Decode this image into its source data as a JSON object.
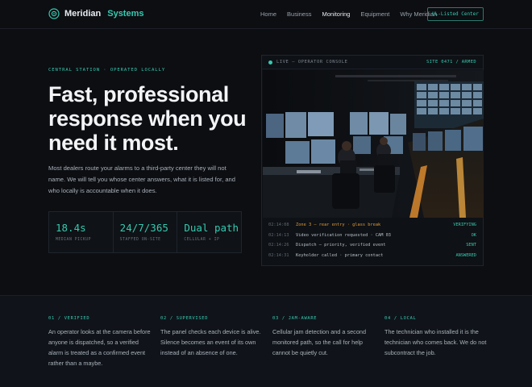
{
  "brand": {
    "name": "Meridian",
    "accent": "Systems",
    "icon": "target-icon"
  },
  "nav": {
    "links": [
      "Home",
      "Business",
      "Monitoring",
      "Equipment",
      "Why Meridian"
    ],
    "active": "Monitoring",
    "cta": "UL-Listed Center"
  },
  "hero": {
    "eyebrow": "Central station · operated locally",
    "headline": "Fast, professional response when you need it most.",
    "lede": "Most dealers route your alarms to a third-party center they will not name. We will tell you whose center answers, what it is listed for, and who locally is accountable when it does."
  },
  "stats": [
    {
      "value": "18.4s",
      "label": "Median pickup"
    },
    {
      "value": "24/7/365",
      "label": "Staffed on-site"
    },
    {
      "value": "Dual path",
      "label": "Cellular + IP"
    }
  ],
  "console": {
    "title": "Live — operator console",
    "site": "Site 0471 / armed",
    "log": [
      {
        "time": "02:14:08",
        "message": "Zone 3 — rear entry · glass break",
        "status": "VERIFYING",
        "alert": true
      },
      {
        "time": "02:14:13",
        "message": "Video verification requested · CAM 03",
        "status": "OK",
        "alert": false
      },
      {
        "time": "02:14:26",
        "message": "Dispatch — priority, verified event",
        "status": "SENT",
        "alert": false
      },
      {
        "time": "02:14:31",
        "message": "Keyholder called · primary contact",
        "status": "ANSWERED",
        "alert": false
      }
    ]
  },
  "features": [
    {
      "eyebrow": "01 / Verified",
      "text": "An operator looks at the camera before anyone is dispatched, so a verified alarm is treated as a confirmed event rather than a maybe."
    },
    {
      "eyebrow": "02 / Supervised",
      "text": "The panel checks each device is alive. Silence becomes an event of its own instead of an absence of one."
    },
    {
      "eyebrow": "03 / Jam-aware",
      "text": "Cellular jam detection and a second monitored path, so the call for help cannot be quietly cut."
    },
    {
      "eyebrow": "04 / Local",
      "text": "The technician who installed it is the technician who comes back. We do not subcontract the job."
    }
  ],
  "colors": {
    "accent": "#36c9b0",
    "background": "#0c0e12",
    "alert": "#e09a3a"
  }
}
